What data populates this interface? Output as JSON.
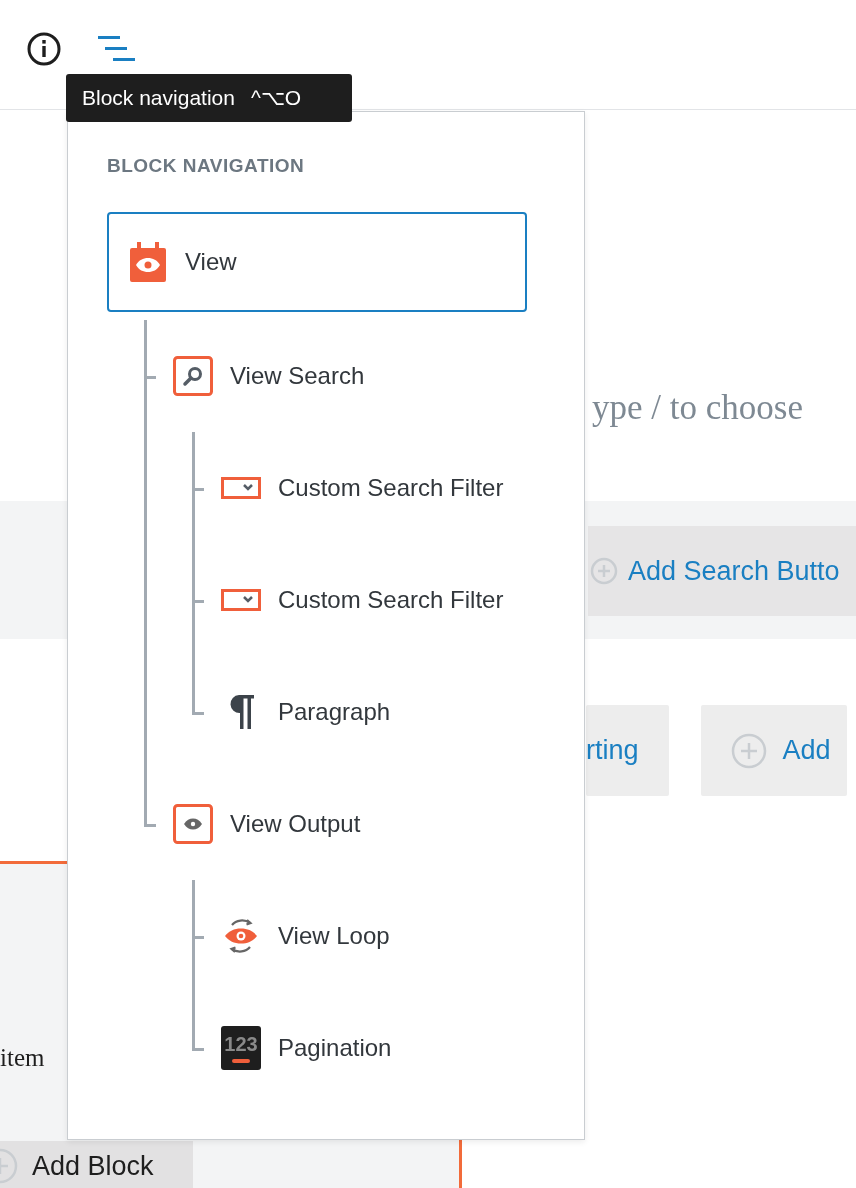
{
  "toolbar": [
    {
      "kind": "info",
      "active": false
    },
    {
      "kind": "block_navigation",
      "active": true
    }
  ],
  "tooltip": {
    "label": "Block navigation",
    "shortcut": "^⌥O"
  },
  "canvas": {
    "placeholder": "ype / to choose",
    "search_button": "Add Search Butto",
    "sorting_button": "rting",
    "add_button": "Add",
    "block_text": "item",
    "add_block_button": "Add Block"
  },
  "block_navigation": {
    "heading": "BLOCK NAVIGATION",
    "items": [
      {
        "label": "View",
        "kind": "view",
        "selected": true,
        "children": [
          {
            "label": "View Search",
            "kind": "search",
            "selected": false,
            "children": [
              {
                "label": "Custom Search Filter",
                "kind": "filter",
                "selected": false
              },
              {
                "label": "Custom Search Filter",
                "kind": "filter",
                "selected": false
              },
              {
                "label": "Paragraph",
                "kind": "paragraph",
                "selected": false
              }
            ]
          },
          {
            "label": "View Output",
            "kind": "output",
            "selected": false,
            "children": [
              {
                "label": "View Loop",
                "kind": "loop",
                "selected": false
              },
              {
                "label": "Pagination",
                "kind": "pagination",
                "icon_text": "123",
                "selected": false
              }
            ]
          }
        ]
      }
    ]
  }
}
